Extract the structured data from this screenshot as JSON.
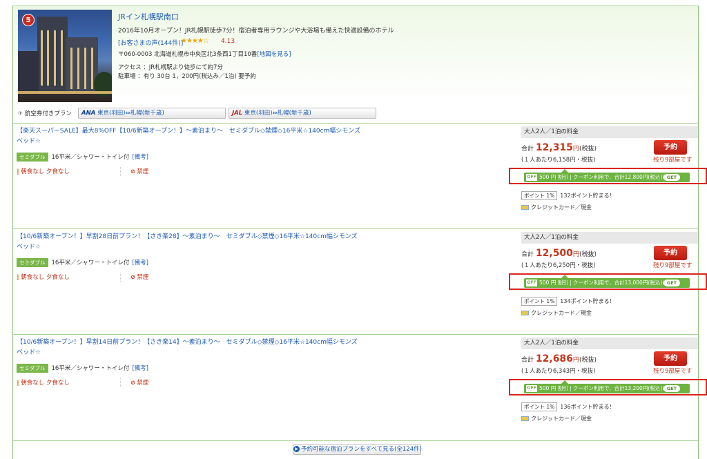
{
  "hotel": {
    "rank": "5",
    "name": "JRイン札幌駅南口",
    "description": "2016年10月オープン！JR札幌駅徒歩7分！宿泊者専用ラウンジや大浴場も備えた快適設備のホテル",
    "review_link": "[お客さまの声(144件)]",
    "stars": "★★★★☆",
    "score": "4.13",
    "address": "〒060-0003  北海道札幌市中央区北3条西1丁目10番",
    "map_link": "[地図を見る]",
    "access": "アクセス  ：JR札幌駅より徒歩にて約7分",
    "parking": "駐車場    ：有り  30台  1，200円(税込み／1泊)  要予約"
  },
  "air": {
    "label": "航空券付きプラン",
    "ana_logo": "ANA",
    "ana_route": "東京(羽田)⇔札幌(新千歳)",
    "jal_logo": "JAL",
    "jal_route": "東京(羽田)⇔札幌(新千歳)"
  },
  "plans": [
    {
      "title": "【楽天スーパーSALE】最大8%OFF【10/6新築オープン！】～素泊まり～　セミダブル◇禁煙◇16平米☆140cm幅シモンズベッド☆",
      "room_tag": "セミダブル",
      "room_info": "16平米／シャワー・トイレ付",
      "note": "[備考]",
      "meal": "朝食なし  夕食なし",
      "smoking": "禁煙",
      "price_head": "大人2人／1泊の料金",
      "price_prefix": "合計",
      "price": "12,315",
      "price_unit": "円",
      "tax": "(税抜)",
      "per_person": "(１人あたり6,158円・税抜)",
      "reserve": "予約",
      "remain": "残り9部屋です",
      "coupon_off": "OFF",
      "coupon_text": "500 円 割引 | クーポン利用で、合計12,800円(税込)に！",
      "coupon_get": "GET",
      "point_tag": "ポイント 1%",
      "point_text": "132ポイント貯まる！",
      "payment": "クレジットカード／現金"
    },
    {
      "title": "【10/6新築オープン！】早割28日前プラン！【さき楽28】～素泊まり～　セミダブル◇禁煙◇16平米☆140cm幅シモンズベッド☆",
      "room_tag": "セミダブル",
      "room_info": "16平米／シャワー・トイレ付",
      "note": "[備考]",
      "meal": "朝食なし  夕食なし",
      "smoking": "禁煙",
      "price_head": "大人2人／1泊の料金",
      "price_prefix": "合計",
      "price": "12,500",
      "price_unit": "円",
      "tax": "(税抜)",
      "per_person": "(１人あたり6,250円・税抜)",
      "reserve": "予約",
      "remain": "残り9部屋です",
      "coupon_off": "OFF",
      "coupon_text": "500 円 割引 | クーポン利用で、合計13,000円(税込)に！",
      "coupon_get": "GET",
      "point_tag": "ポイント 1%",
      "point_text": "134ポイント貯まる！",
      "payment": "クレジットカード／現金"
    },
    {
      "title": "【10/6新築オープン！】早割14日前プラン！【さき楽14】～素泊まり～　セミダブル◇禁煙◇16平米☆140cm幅シモンズベッド☆",
      "room_tag": "セミダブル",
      "room_info": "16平米／シャワー・トイレ付",
      "note": "[備考]",
      "meal": "朝食なし  夕食なし",
      "smoking": "禁煙",
      "price_head": "大人2人／1泊の料金",
      "price_prefix": "合計",
      "price": "12,686",
      "price_unit": "円",
      "tax": "(税抜)",
      "per_person": "(１人あたり6,343円・税抜)",
      "reserve": "予約",
      "remain": "残り9部屋です",
      "coupon_off": "OFF",
      "coupon_text": "500 円 割引 | クーポン利用で、合計13,200円(税込)に！",
      "coupon_get": "GET",
      "point_tag": "ポイント 1%",
      "point_text": "136ポイント貯まる！",
      "payment": "クレジットカード／現金"
    }
  ],
  "more": {
    "label": "予約可能な宿泊プランをすべて見る(全124件)"
  },
  "colors": {
    "accent_green": "#6db33f",
    "link_blue": "#1d5bb5",
    "price_red": "#c4361c",
    "highlight_box": "#d9251d"
  }
}
